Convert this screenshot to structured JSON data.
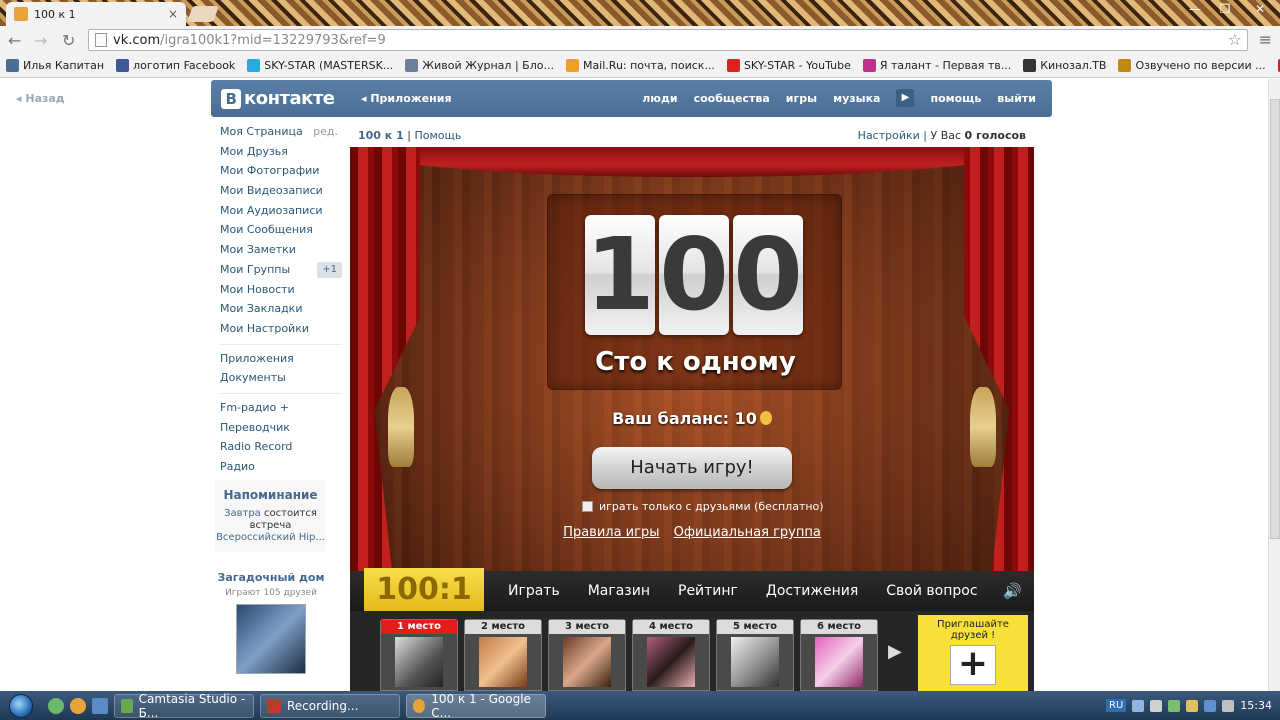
{
  "browser": {
    "tab_title": "100 к 1",
    "tab_close": "×",
    "window_controls": [
      "—",
      "❐",
      "✕"
    ],
    "url_host": "vk.com",
    "url_path": "/igra100k1?mid=13229793&ref=9",
    "back_arrow": "←",
    "forward_arrow": "→",
    "reload": "↻",
    "star": "☆",
    "wrench": "≡",
    "bookmarks": [
      {
        "label": "Илья Капитан",
        "color": "#4a6d94"
      },
      {
        "label": "логотип Facebook",
        "color": "#3b5998"
      },
      {
        "label": "SKY-STAR (MASTERSK...",
        "color": "#29a9e1"
      },
      {
        "label": "Живой Журнал | Бло...",
        "color": "#6d7f99"
      },
      {
        "label": "Mail.Ru: почта, поиск...",
        "color": "#f0a020"
      },
      {
        "label": "SKY-STAR - YouTube",
        "color": "#e02020"
      },
      {
        "label": "Я талант - Первая тв...",
        "color": "#c0308a"
      },
      {
        "label": "Кинозал.ТВ",
        "color": "#333333"
      },
      {
        "label": "Озвучено по версии ...",
        "color": "#c08a10"
      }
    ]
  },
  "vk": {
    "back_label": "Назад",
    "logo_b": "В",
    "logo_text": "контакте",
    "apps_label": "◂ Приложения",
    "nav": [
      "люди",
      "сообщества",
      "игры",
      "музыка",
      "помощь",
      "выйти"
    ],
    "play_icon": "▶",
    "left_menu": [
      {
        "label": "Моя Страница",
        "extra": "ред."
      },
      {
        "label": "Мои Друзья"
      },
      {
        "label": "Мои Фотографии"
      },
      {
        "label": "Мои Видеозаписи"
      },
      {
        "label": "Мои Аудиозаписи"
      },
      {
        "label": "Мои Сообщения"
      },
      {
        "label": "Мои Заметки"
      },
      {
        "label": "Мои Группы",
        "badge": "+1"
      },
      {
        "label": "Мои Новости"
      },
      {
        "label": "Мои Закладки"
      },
      {
        "label": "Мои Настройки"
      }
    ],
    "left_menu_2": [
      "Приложения",
      "Документы"
    ],
    "left_menu_3": [
      "Fm-радио +",
      "Переводчик",
      "Radio Record",
      "Радио"
    ],
    "reminder": {
      "title": "Напоминание",
      "line1_a": "Завтра",
      "line1_b": "состоится встреча",
      "line2": "Всероссийский Hip..."
    },
    "mystery": {
      "title": "Загадочный дом",
      "subtitle": "Играют 105 друзей"
    },
    "appbar": {
      "app_name": "100 к 1",
      "help": "Помощь",
      "settings": "Настройки",
      "votes_prefix": "У Вас",
      "votes": "0 голосов"
    }
  },
  "game": {
    "digits": [
      "1",
      "0",
      "0"
    ],
    "title": "Сто к одному",
    "balance_label": "Ваш баланс: 10",
    "start_button": "Начать игру!",
    "friends_only": "играть только с друзьями (бесплатно)",
    "rules_link": "Правила игры",
    "group_link": "Официальная группа",
    "brand": "100:1",
    "menu": [
      "Играть",
      "Магазин",
      "Рейтинг",
      "Достижения",
      "Свой вопрос"
    ],
    "sound_icon": "🔊",
    "places": [
      "1 место",
      "2 место",
      "3 место",
      "4 место",
      "5 место",
      "6 место"
    ],
    "arrow_right": "▶",
    "invite_label": "Приглашайте друзей !",
    "invite_plus": "+"
  },
  "taskbar": {
    "tasks": [
      {
        "label": "Camtasia Studio - Б...",
        "color": "#6aa84f"
      },
      {
        "label": "Recording...",
        "color": "#c0392b"
      },
      {
        "label": "100 к 1 - Google C...",
        "color": "#e8a33a"
      }
    ],
    "lang": "RU",
    "clock": "15:34"
  }
}
